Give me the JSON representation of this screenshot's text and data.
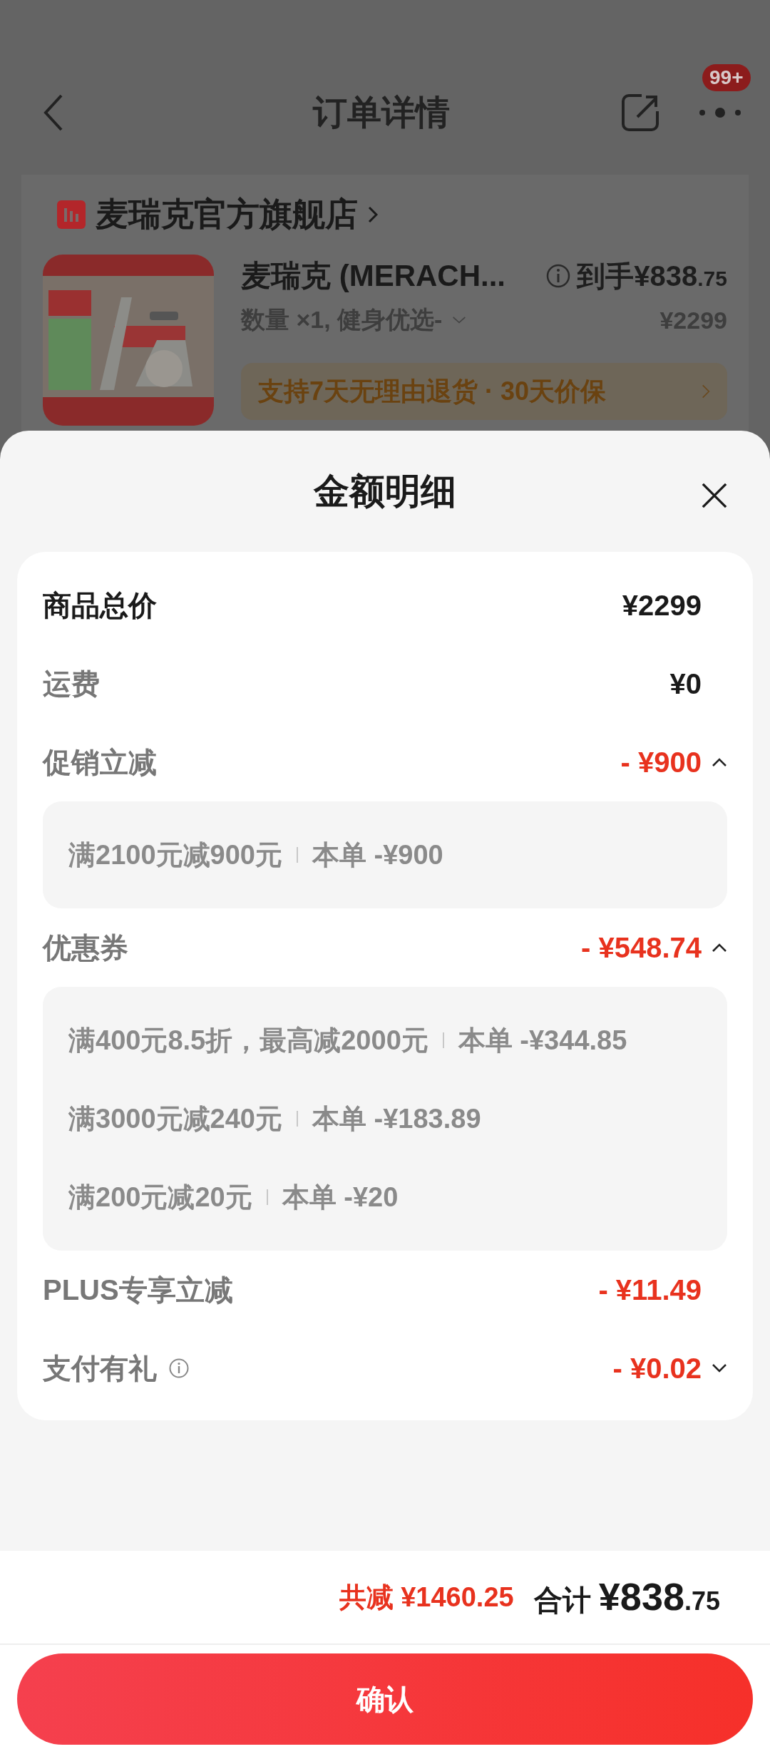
{
  "header": {
    "title": "订单详情",
    "badge": "99+"
  },
  "store": {
    "name": "麦瑞克官方旗舰店"
  },
  "product": {
    "title": "麦瑞克 (MERACH...",
    "price_main": "到手¥838",
    "price_cents": ".75",
    "original_price": "¥2299",
    "spec": "数量 ×1, 健身优选-",
    "service": "支持7天无理由退货 · 30天价保"
  },
  "sheet": {
    "title": "金额明细",
    "rows": [
      {
        "kind": "total",
        "label": "商品总价",
        "value": "¥2299",
        "info": false
      },
      {
        "kind": "plain",
        "label": "运费",
        "value": "¥0",
        "info": false
      },
      {
        "kind": "discount",
        "label": "促销立减",
        "value": "- ¥900",
        "info": false,
        "expanded": true,
        "details": [
          {
            "rule": "满2100元减900元",
            "amount": "本单 -¥900"
          }
        ]
      },
      {
        "kind": "discount",
        "label": "优惠券",
        "value": "- ¥548.74",
        "info": false,
        "expanded": true,
        "details": [
          {
            "rule": "满400元8.5折，最高减2000元",
            "amount": "本单 -¥344.85"
          },
          {
            "rule": "满3000元减240元",
            "amount": "本单 -¥183.89"
          },
          {
            "rule": "满200元减20元",
            "amount": "本单 -¥20"
          }
        ]
      },
      {
        "kind": "discount",
        "label": "PLUS专享立减",
        "value": "- ¥11.49",
        "info": false
      },
      {
        "kind": "discount",
        "label": "支付有礼",
        "value": "- ¥0.02",
        "info": true,
        "expanded": false
      }
    ]
  },
  "summary": {
    "saved_label": "共减",
    "saved_value": "¥1460.25",
    "total_label": "合计",
    "total_main": "¥838",
    "total_cents": ".75"
  },
  "confirm_button": "确认"
}
